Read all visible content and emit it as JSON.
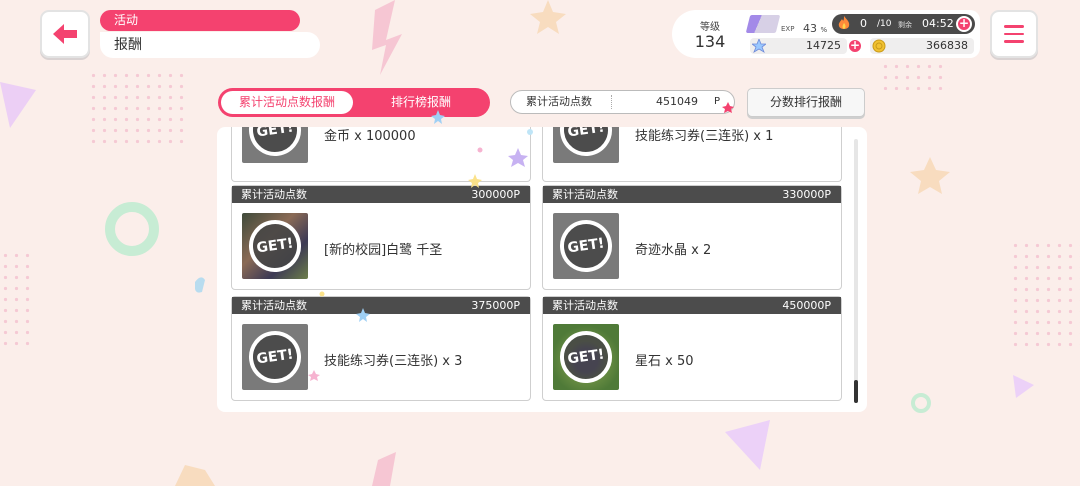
{
  "header": {
    "category": "活动",
    "title": "报酬"
  },
  "status": {
    "level_label": "等级",
    "level_value": "134",
    "exp_label": "EXP",
    "exp_percent": "43",
    "exp_unit": "%",
    "exp_fraction": 0.43,
    "stamina_value": "0",
    "stamina_max": "/10",
    "remaining_label": "剩余",
    "timer": "04:52",
    "stars": "14725",
    "coins": "366838"
  },
  "tabs": [
    {
      "label": "累计活动点数报酬",
      "active": true
    },
    {
      "label": "排行榜报酬",
      "active": false
    }
  ],
  "points": {
    "label": "累计活动点数",
    "value": "451049",
    "unit": "P"
  },
  "ranking_button": "分数排行报酬",
  "get_label": "GET!",
  "partial_rows": [
    {
      "reward": "金币 x 100000"
    },
    {
      "reward": "技能练习券(三连张) x 1"
    }
  ],
  "cards": [
    {
      "header": "累计活动点数",
      "requirement": "300000P",
      "reward": "[新的校园]白鹭 千圣",
      "art": "card"
    },
    {
      "header": "累计活动点数",
      "requirement": "330000P",
      "reward": "奇迹水晶 x 2",
      "art": "plain"
    },
    {
      "header": "累计活动点数",
      "requirement": "375000P",
      "reward": "技能练习券(三连张) x 3",
      "art": "plain"
    },
    {
      "header": "累计活动点数",
      "requirement": "450000P",
      "reward": "星石 x 50",
      "art": "star"
    }
  ],
  "colors": {
    "accent": "#f4426f",
    "background": "#fbeeea",
    "card_header": "#4c4c4c"
  }
}
